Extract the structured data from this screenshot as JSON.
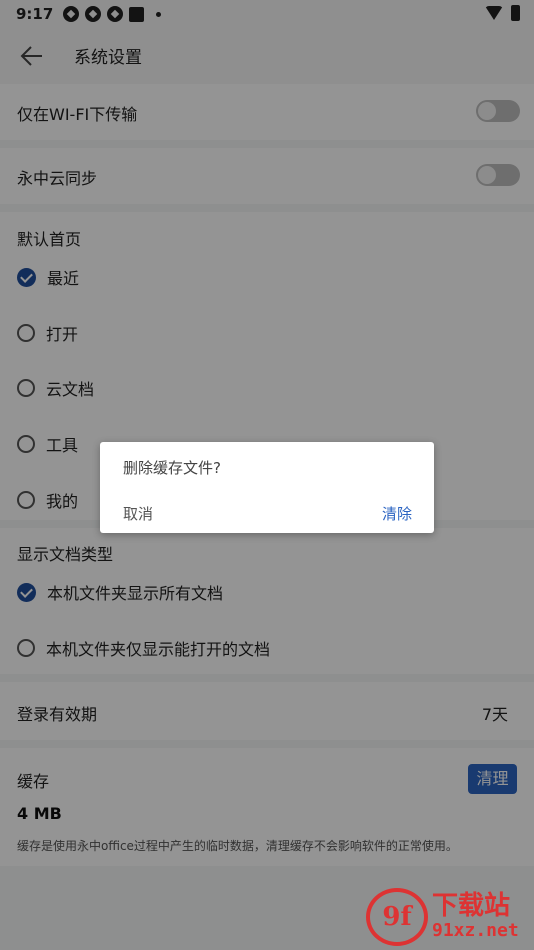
{
  "status_bar": {
    "time": "9:17"
  },
  "app_bar": {
    "title": "系统设置"
  },
  "settings": {
    "wifi_only": {
      "label": "仅在WI-FI下传输",
      "enabled": false
    },
    "cloud_sync": {
      "label": "永中云同步",
      "enabled": false
    }
  },
  "default_home": {
    "heading": "默认首页",
    "options": [
      {
        "label": "最近",
        "selected": true
      },
      {
        "label": "打开",
        "selected": false
      },
      {
        "label": "云文档",
        "selected": false
      },
      {
        "label": "工具",
        "selected": false
      },
      {
        "label": "我的",
        "selected": false
      }
    ]
  },
  "doc_types": {
    "heading": "显示文档类型",
    "options": [
      {
        "label": "本机文件夹显示所有文档",
        "selected": true
      },
      {
        "label": "本机文件夹仅显示能打开的文档",
        "selected": false
      }
    ]
  },
  "login_validity": {
    "label": "登录有效期",
    "value": "7天"
  },
  "cache": {
    "label": "缓存",
    "clear_button": "清理",
    "size": "4 MB",
    "note": "缓存是使用永中office过程中产生的临时数据，清理缓存不会影响软件的正常使用。"
  },
  "dialog": {
    "message": "删除缓存文件?",
    "cancel": "取消",
    "confirm": "清除"
  },
  "watermark": {
    "line1": "下载站",
    "line2": "91xz.net",
    "logo": "9f"
  },
  "colors": {
    "accent": "#2b64c2",
    "check": "#1f4e9c",
    "watermark": "#dd3333"
  }
}
